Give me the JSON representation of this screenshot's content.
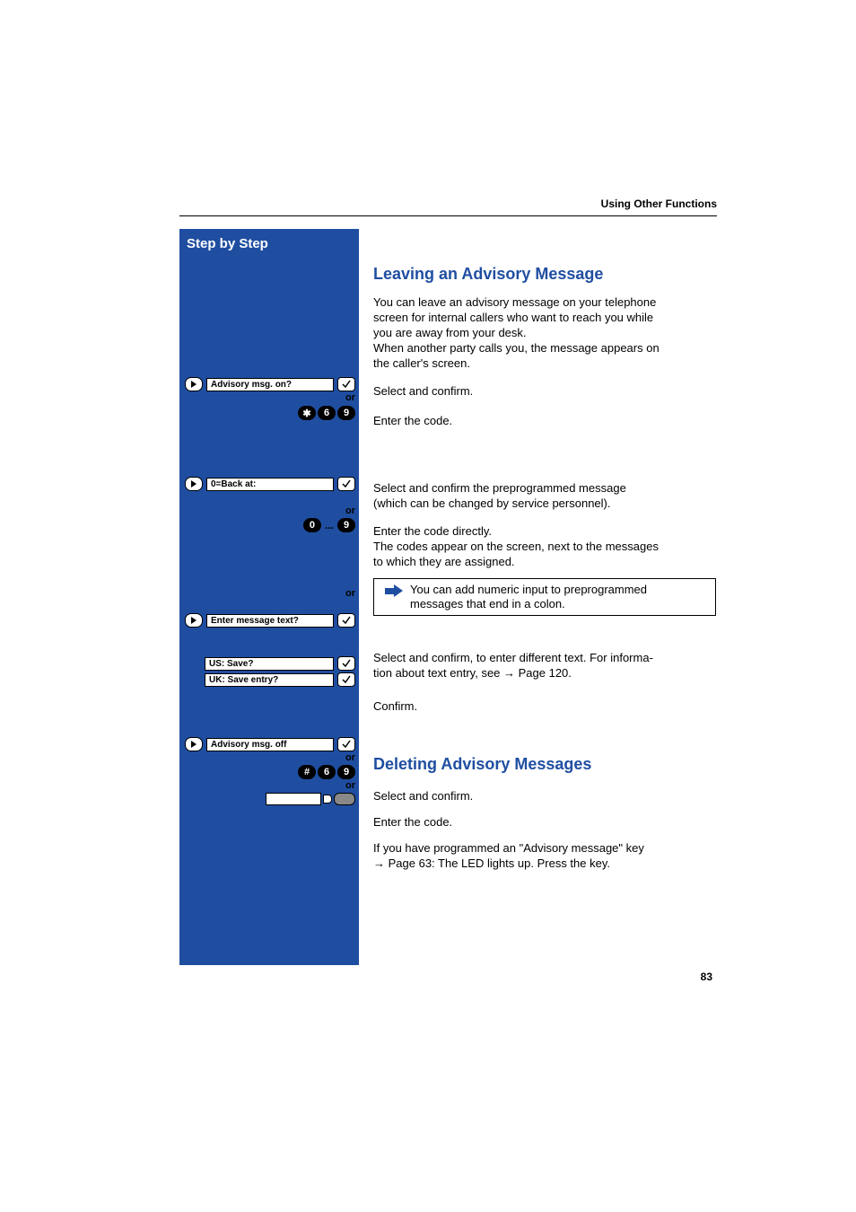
{
  "header": {
    "running_head": "Using Other Functions"
  },
  "sidebar": {
    "title": "Step by Step"
  },
  "page_number": "83",
  "section1": {
    "title": "Leaving an Advisory Message",
    "intro_l1": "You can leave an advisory message on your telephone",
    "intro_l2": "screen for internal callers who want to reach you while",
    "intro_l3": "you are away from your desk.",
    "intro_l4": "When another party calls you, the message appears on",
    "intro_l5": "the caller's screen.",
    "step1_text": "Select and confirm.",
    "step1_code_text": "Enter the code.",
    "step1_label": "Advisory msg. on?",
    "or": "or",
    "code_keys": [
      "✱",
      "6",
      "9"
    ],
    "step2_label": "0=Back at:",
    "step2_text_l1": "Select and confirm the preprogrammed message",
    "step2_text_l2": "(which can be changed by service personnel).",
    "step2_code_l1": "Enter the code directly.",
    "step2_code_l2": "The codes appear on the screen, next to the messages",
    "step2_code_l3": "to which they are assigned.",
    "range_keys": [
      "0",
      "9"
    ],
    "note_l1": "You can add numeric input to preprogrammed",
    "note_l2": "messages that end in a colon.",
    "step3_label": "Enter message text?",
    "step3_text_l1": "Select and confirm, to enter different text. For informa-",
    "step3_text_l2": "tion about text entry, see → Page 120.",
    "step4_us": "US: Save?",
    "step4_uk": "UK: Save entry?",
    "step4_text": "Confirm."
  },
  "section2": {
    "title": "Deleting Advisory Messages",
    "step1_label": "Advisory msg. off",
    "step1_text": "Select and confirm.",
    "or": "or",
    "code_keys": [
      "#",
      "6",
      "9"
    ],
    "code_text": "Enter the code.",
    "prog_text_l1": "If you have programmed an \"Advisory message\" key",
    "prog_text_l2": "→ Page 63: The LED lights up. Press the key."
  }
}
